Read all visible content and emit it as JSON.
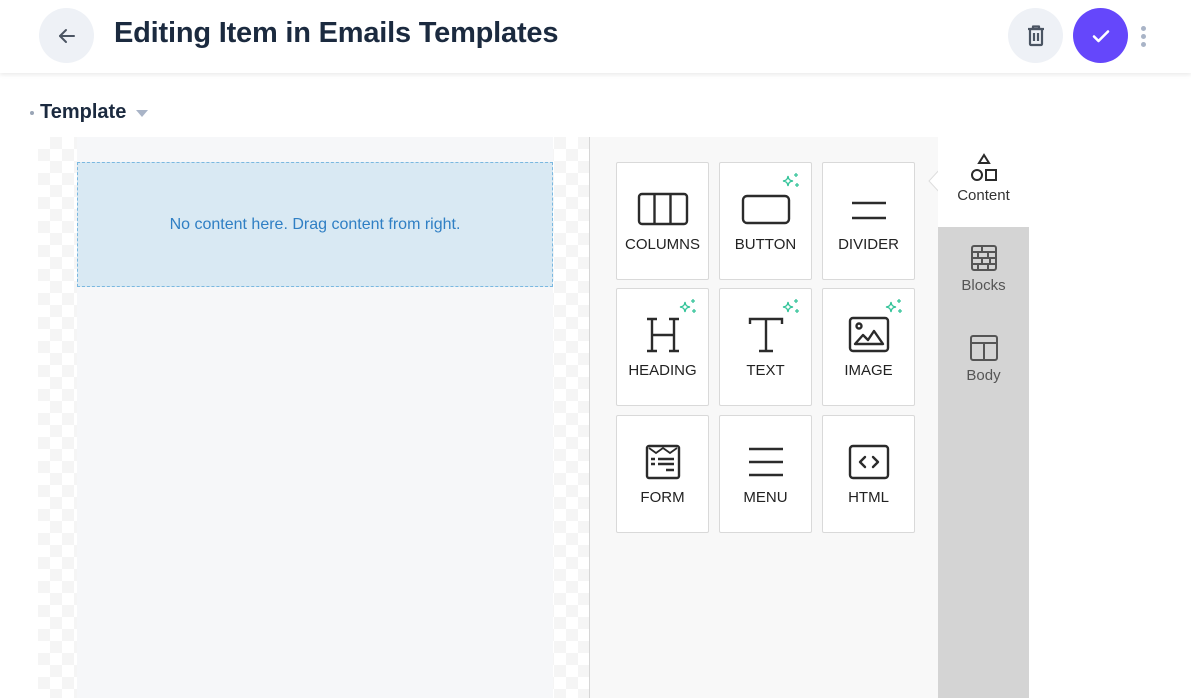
{
  "header": {
    "title": "Editing Item in Emails Templates",
    "back_icon": "arrow-left-icon",
    "delete_icon": "trash-icon",
    "save_icon": "check-icon",
    "more_icon": "kebab-menu-icon",
    "accent_color": "#6547fb"
  },
  "section": {
    "label": "Template"
  },
  "canvas": {
    "empty_message": "No content here. Drag content from right."
  },
  "content_tiles": [
    {
      "label": "COLUMNS",
      "icon": "columns-icon",
      "ai": false
    },
    {
      "label": "BUTTON",
      "icon": "button-icon",
      "ai": true
    },
    {
      "label": "DIVIDER",
      "icon": "divider-icon",
      "ai": false
    },
    {
      "label": "HEADING",
      "icon": "heading-icon",
      "ai": true
    },
    {
      "label": "TEXT",
      "icon": "text-icon",
      "ai": true
    },
    {
      "label": "IMAGE",
      "icon": "image-icon",
      "ai": true
    },
    {
      "label": "FORM",
      "icon": "form-icon",
      "ai": false
    },
    {
      "label": "MENU",
      "icon": "menu-icon",
      "ai": false
    },
    {
      "label": "HTML",
      "icon": "html-icon",
      "ai": false
    }
  ],
  "side_tabs": [
    {
      "label": "Content",
      "icon": "shapes-icon",
      "active": true
    },
    {
      "label": "Blocks",
      "icon": "blocks-icon",
      "active": false
    },
    {
      "label": "Body",
      "icon": "body-layout-icon",
      "active": false
    }
  ]
}
